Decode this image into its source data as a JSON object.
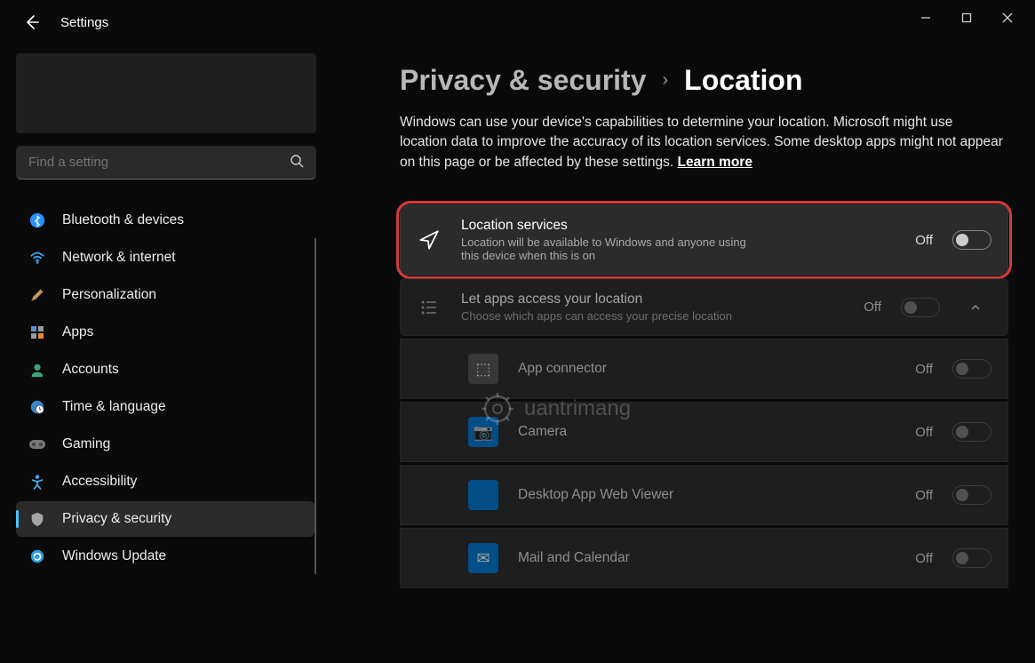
{
  "window": {
    "app_title": "Settings"
  },
  "search": {
    "placeholder": "Find a setting"
  },
  "nav": {
    "items": [
      {
        "label": "Bluetooth & devices"
      },
      {
        "label": "Network & internet"
      },
      {
        "label": "Personalization"
      },
      {
        "label": "Apps"
      },
      {
        "label": "Accounts"
      },
      {
        "label": "Time & language"
      },
      {
        "label": "Gaming"
      },
      {
        "label": "Accessibility"
      },
      {
        "label": "Privacy & security"
      },
      {
        "label": "Windows Update"
      }
    ],
    "active_index": 8
  },
  "breadcrumb": {
    "parent": "Privacy & security",
    "current": "Location"
  },
  "description": {
    "text": "Windows can use your device's capabilities to determine your location. Microsoft might use location data to improve the accuracy of its location services. Some desktop apps might not appear on this page or be affected by these settings.  ",
    "learn_more": "Learn more"
  },
  "location_services": {
    "title": "Location services",
    "subtitle": "Location will be available to Windows and anyone using this device when this is on",
    "state": "Off"
  },
  "apps_access": {
    "title": "Let apps access your location",
    "subtitle": "Choose which apps can access your precise location",
    "state": "Off"
  },
  "apps": [
    {
      "name": "App connector",
      "state": "Off",
      "color": "#555",
      "icon": "⬚"
    },
    {
      "name": "Camera",
      "state": "Off",
      "color": "#0078d4",
      "icon": "📷"
    },
    {
      "name": "Desktop App Web Viewer",
      "state": "Off",
      "color": "#0078d4",
      "icon": ""
    },
    {
      "name": "Mail and Calendar",
      "state": "Off",
      "color": "#0078d4",
      "icon": "✉"
    }
  ],
  "watermark": "uantrimang"
}
